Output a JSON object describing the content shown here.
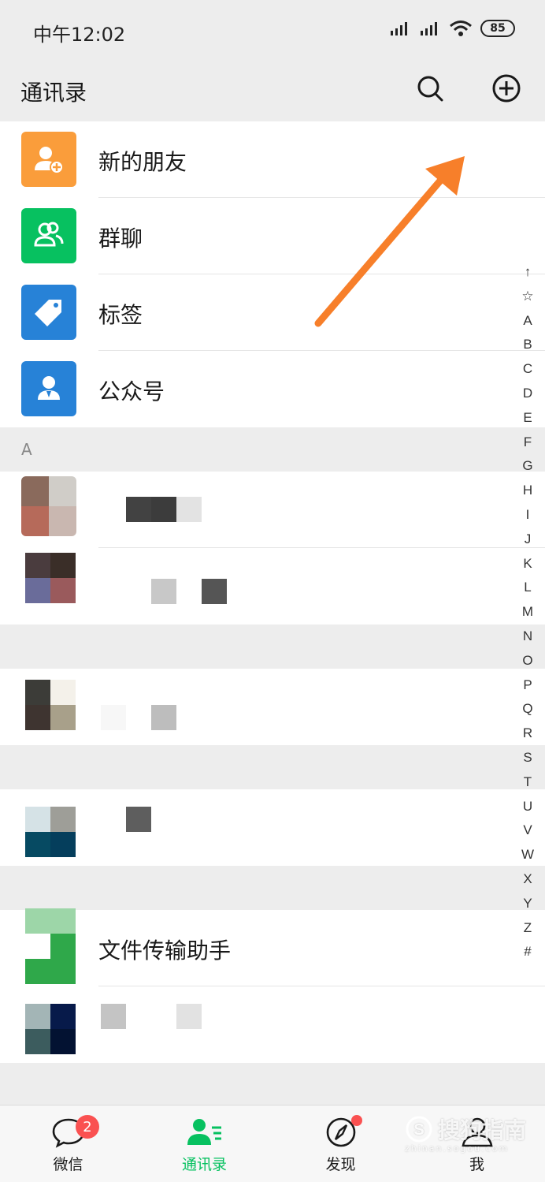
{
  "status_bar": {
    "time": "中午12:02",
    "battery": "85"
  },
  "header": {
    "title": "通讯录"
  },
  "menu_items": [
    {
      "label": "新的朋友",
      "color": "#fa9d3b",
      "icon": "add-friend-icon"
    },
    {
      "label": "群聊",
      "color": "#07c160",
      "icon": "group-chat-icon"
    },
    {
      "label": "标签",
      "color": "#2782d7",
      "icon": "tag-icon"
    },
    {
      "label": "公众号",
      "color": "#2782d7",
      "icon": "official-account-icon"
    }
  ],
  "section_a": "A",
  "contacts": [
    {
      "name": "文件传输助手"
    }
  ],
  "index_letters": [
    "↑",
    "☆",
    "A",
    "B",
    "C",
    "D",
    "E",
    "F",
    "G",
    "H",
    "I",
    "J",
    "K",
    "L",
    "M",
    "N",
    "O",
    "P",
    "Q",
    "R",
    "S",
    "T",
    "U",
    "V",
    "W",
    "X",
    "Y",
    "Z",
    "#"
  ],
  "tabs": [
    {
      "label": "微信",
      "badge": "2",
      "icon": "chat-bubble-icon"
    },
    {
      "label": "通讯录",
      "icon": "contacts-icon",
      "active": true
    },
    {
      "label": "发现",
      "icon": "compass-icon",
      "dot": true
    },
    {
      "label": "我",
      "icon": "profile-icon"
    }
  ],
  "watermark": {
    "text": "搜狗指南",
    "sub": "zhinan.sogou.com"
  },
  "colors": {
    "active": "#07c160",
    "badge": "#fa5151",
    "annotation_arrow": "#f77f2a"
  }
}
